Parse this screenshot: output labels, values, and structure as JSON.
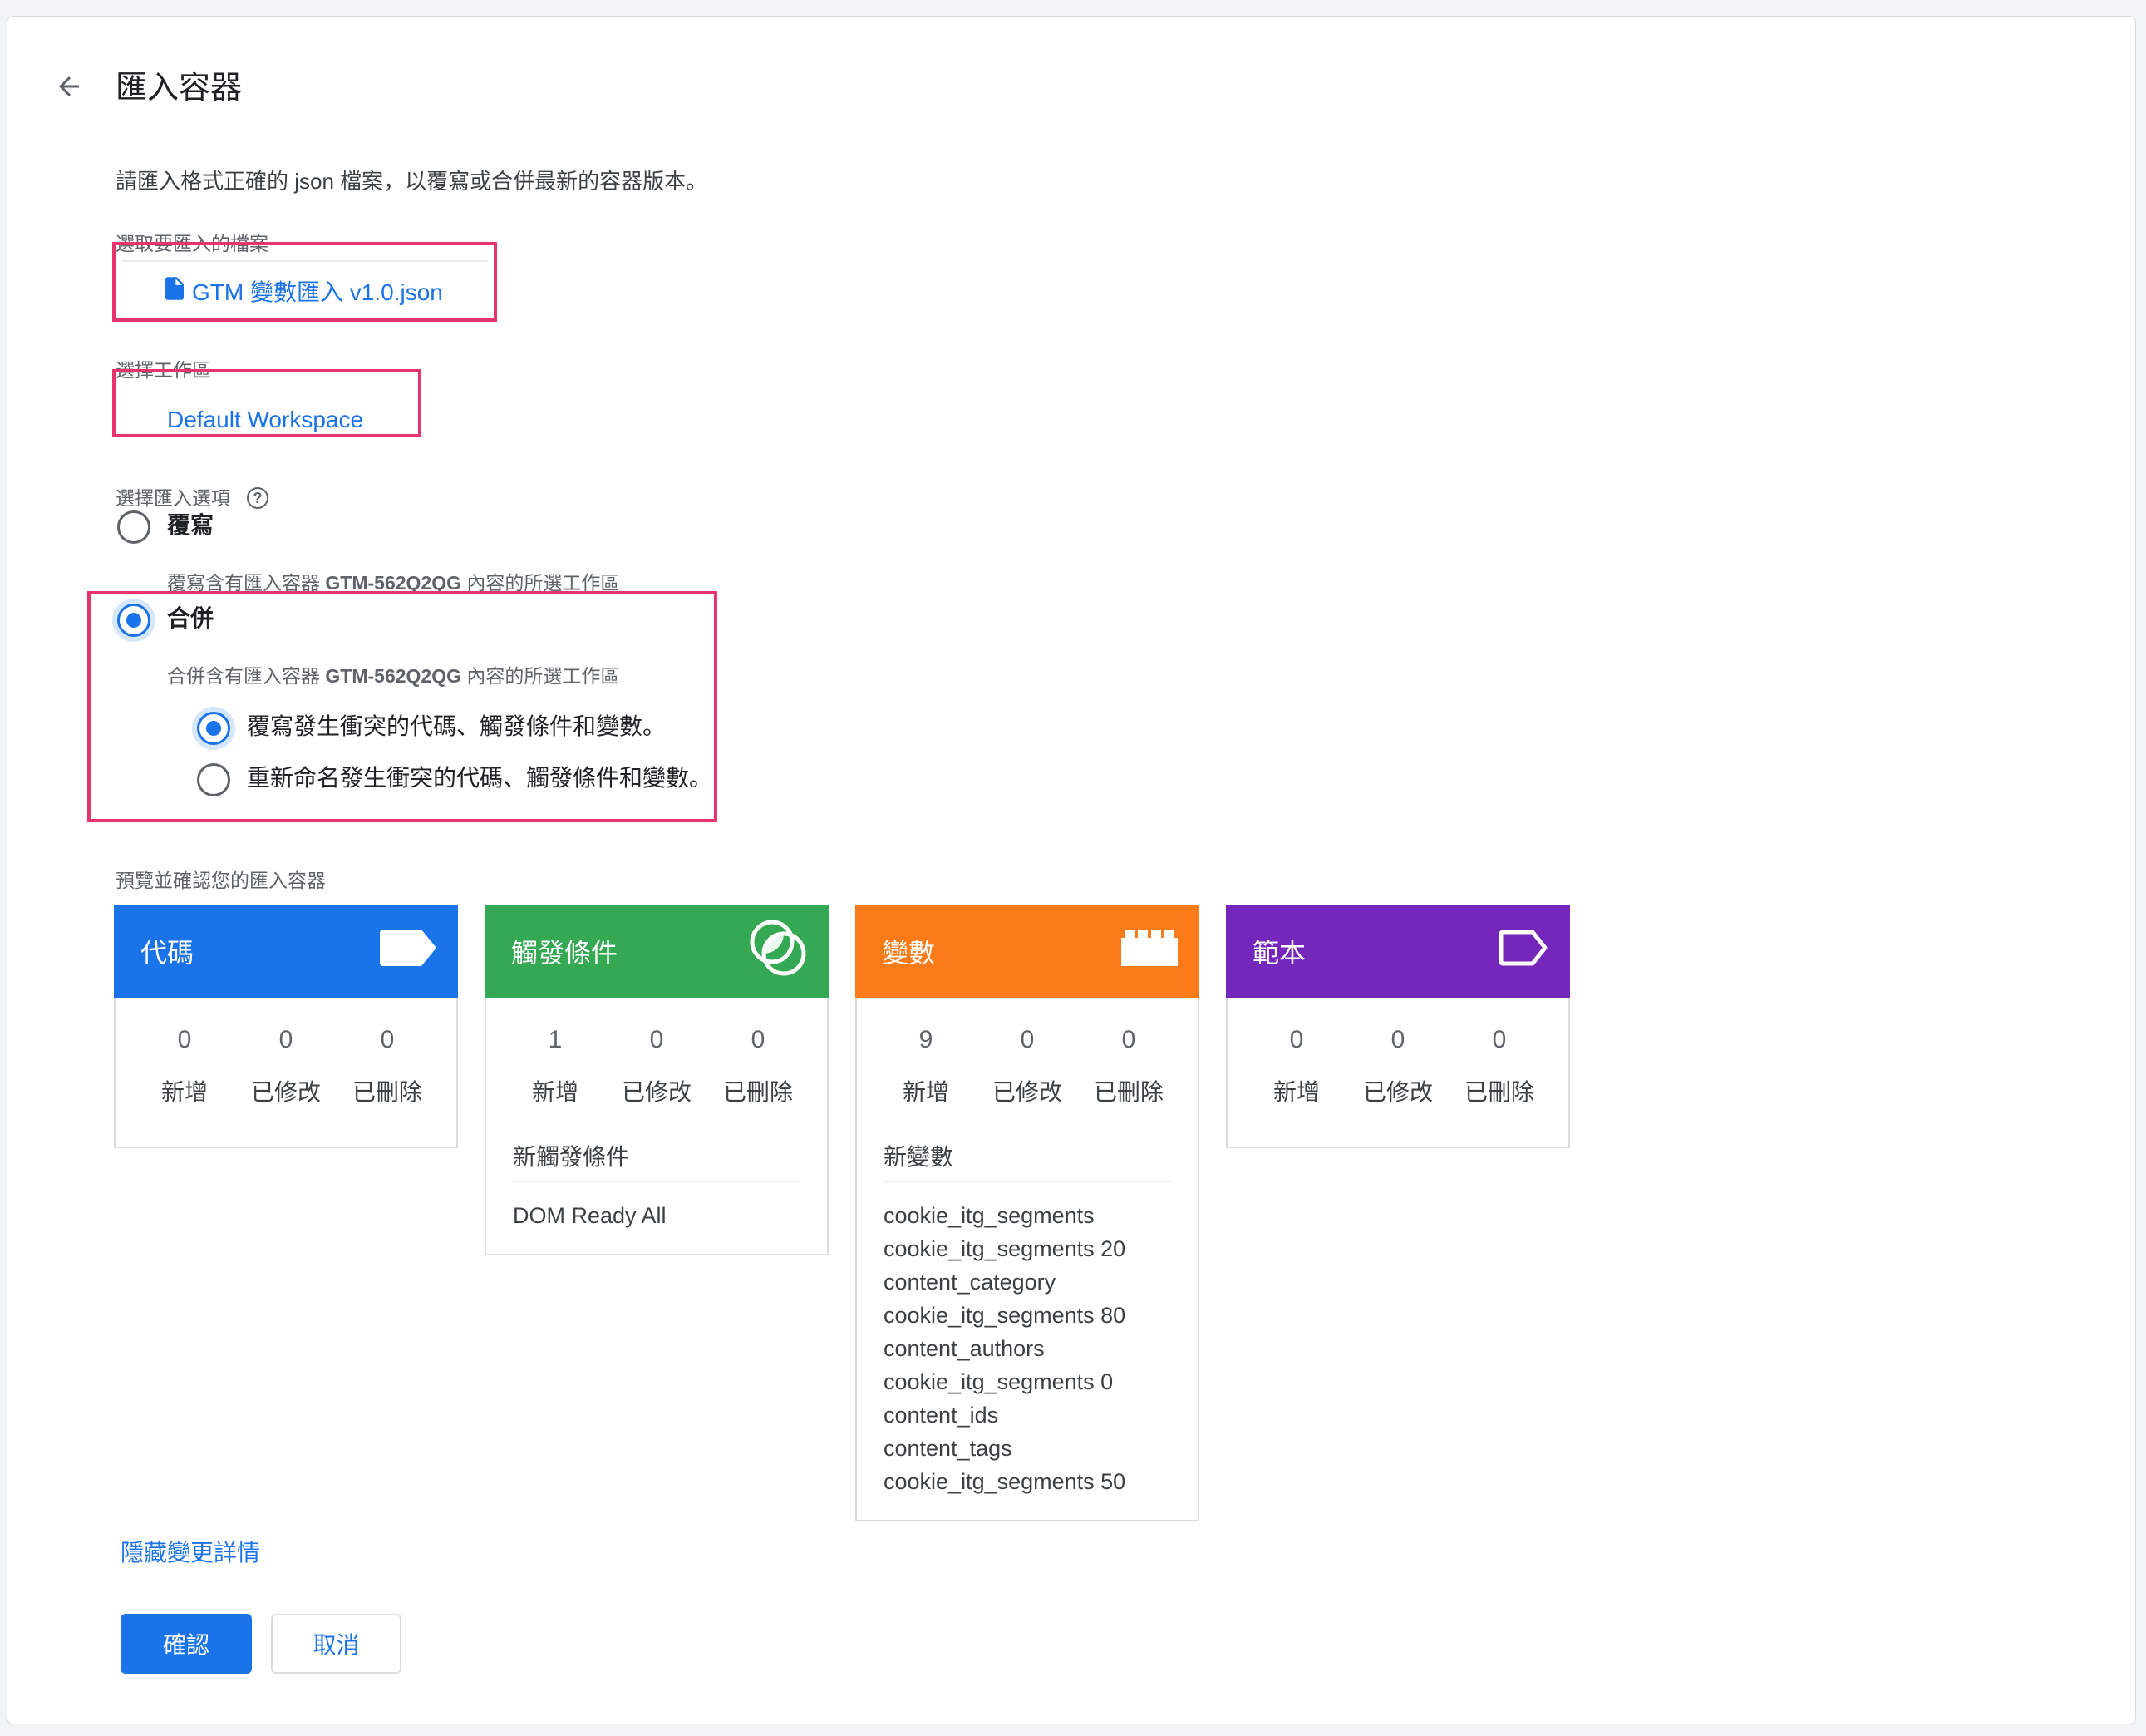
{
  "header": {
    "back_icon": "arrow-back-icon",
    "title": "匯入容器"
  },
  "description": "請匯入格式正確的 json 檔案，以覆寫或合併最新的容器版本。",
  "file": {
    "label": "選取要匯入的檔案",
    "name": "GTM 變數匯入 v1.0.json",
    "icon": "file-icon"
  },
  "workspace": {
    "label": "選擇工作區",
    "value": "Default Workspace"
  },
  "import_option": {
    "label": "選擇匯入選項",
    "help_icon": "help-icon",
    "overwrite": {
      "label": "覆寫",
      "desc_prefix": "覆寫含有匯入容器",
      "container_id": "GTM-562Q2QG",
      "desc_suffix": "內容的所選工作區",
      "selected": false
    },
    "merge": {
      "label": "合併",
      "desc_prefix": "合併含有匯入容器",
      "container_id": "GTM-562Q2QG",
      "desc_suffix": "內容的所選工作區",
      "selected": true,
      "sub_options": [
        {
          "label": "覆寫發生衝突的代碼、觸發條件和變數。",
          "selected": true
        },
        {
          "label": "重新命名發生衝突的代碼、觸發條件和變數。",
          "selected": false
        }
      ]
    }
  },
  "preview": {
    "label": "預覽並確認您的匯入容器",
    "stat_labels": [
      "新增",
      "已修改",
      "已刪除"
    ],
    "tiles": [
      {
        "title": "代碼",
        "icon": "tag-icon",
        "color": "#1a73e8",
        "added": "0",
        "modified": "0",
        "deleted": "0"
      },
      {
        "title": "觸發條件",
        "icon": "trigger-icon",
        "color": "#34a853",
        "added": "1",
        "modified": "0",
        "deleted": "0",
        "list_title": "新觸發條件",
        "items": [
          "DOM Ready All"
        ]
      },
      {
        "title": "變數",
        "icon": "variable-brick-icon",
        "color": "#fa7b17",
        "added": "9",
        "modified": "0",
        "deleted": "0",
        "list_title": "新變數",
        "items": [
          "cookie_itg_segments",
          "cookie_itg_segments 20",
          "content_category",
          "cookie_itg_segments 80",
          "content_authors",
          "cookie_itg_segments 0",
          "content_ids",
          "content_tags",
          "cookie_itg_segments 50"
        ]
      },
      {
        "title": "範本",
        "icon": "template-tag-icon",
        "color": "#7627bb",
        "added": "0",
        "modified": "0",
        "deleted": "0"
      }
    ]
  },
  "hide_details": "隱藏變更詳情",
  "actions": {
    "confirm": "確認",
    "cancel": "取消"
  }
}
